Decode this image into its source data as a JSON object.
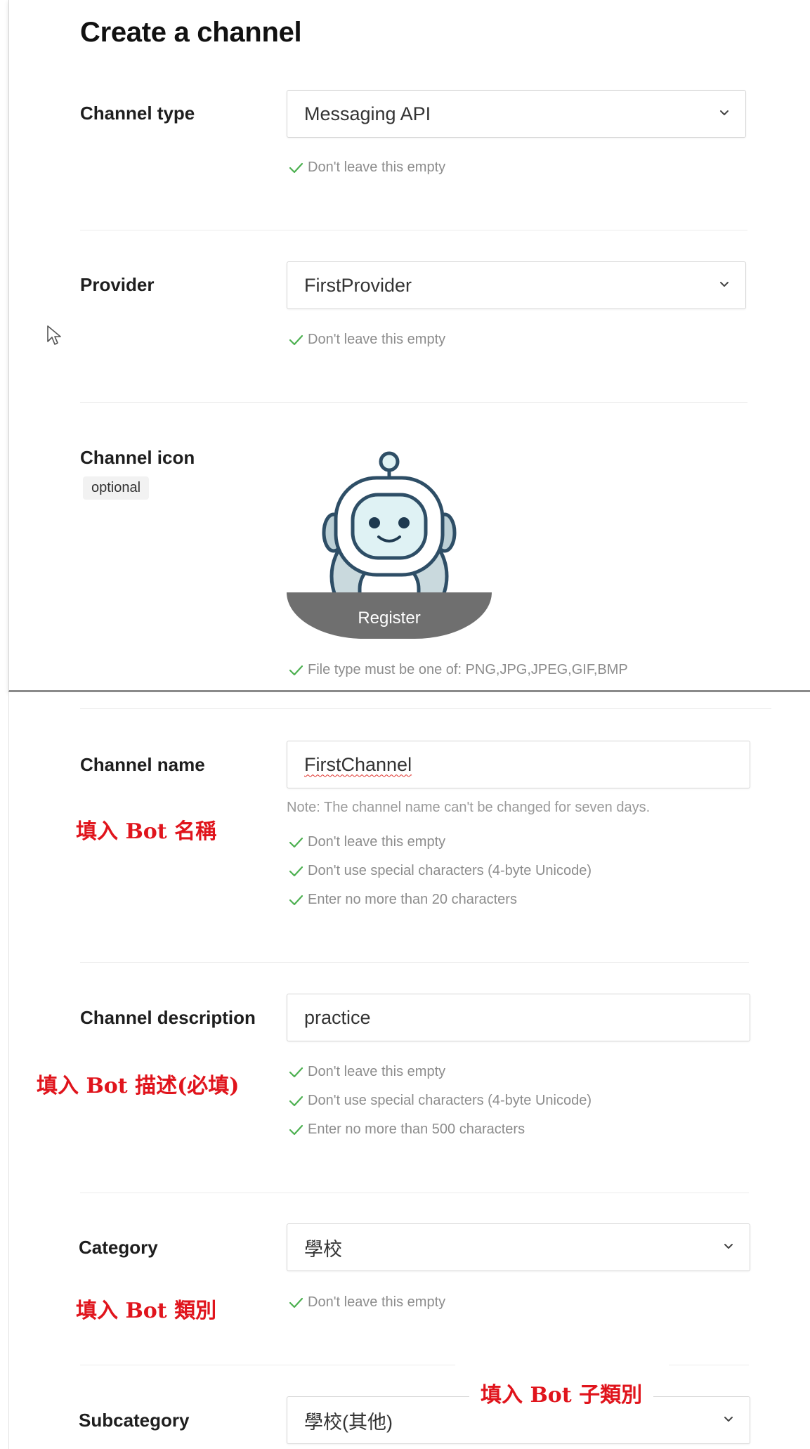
{
  "page": {
    "title": "Create a channel"
  },
  "fields": {
    "channel_type": {
      "label": "Channel type",
      "value": "Messaging API",
      "hints": [
        "Don't leave this empty"
      ]
    },
    "provider": {
      "label": "Provider",
      "value": "FirstProvider",
      "hints": [
        "Don't leave this empty"
      ]
    },
    "channel_icon": {
      "label": "Channel icon",
      "optional": "optional",
      "register_label": "Register",
      "hints": [
        "File type must be one of: PNG,JPG,JPEG,GIF,BMP"
      ]
    },
    "channel_name": {
      "label": "Channel name",
      "value": "FirstChannel",
      "note": "Note: The channel name can't be changed for seven days.",
      "hints": [
        "Don't leave this empty",
        "Don't use special characters (4-byte Unicode)",
        "Enter no more than 20 characters"
      ]
    },
    "channel_description": {
      "label": "Channel description",
      "value": "practice",
      "hints": [
        "Don't leave this empty",
        "Don't use special characters (4-byte Unicode)",
        "Enter no more than 500 characters"
      ]
    },
    "category": {
      "label": "Category",
      "value": "學校",
      "hints": [
        "Don't leave this empty"
      ]
    },
    "subcategory": {
      "label": "Subcategory",
      "value": "學校(其他)"
    }
  },
  "annotations": {
    "name": "填入 Bot 名稱",
    "description": "填入 Bot 描述(必填)",
    "category": "填入 Bot 類別",
    "subcategory": "填入 Bot 子類別"
  },
  "colors": {
    "check_green": "#4cb050",
    "annotation_red": "#e0141c",
    "register_band": "#6f6f6f",
    "hint_gray": "#8c8c8c"
  },
  "icons": {
    "select_chevron": "chevron-down-icon",
    "hint_check": "check-icon",
    "mouse": "cursor-arrow-icon"
  }
}
